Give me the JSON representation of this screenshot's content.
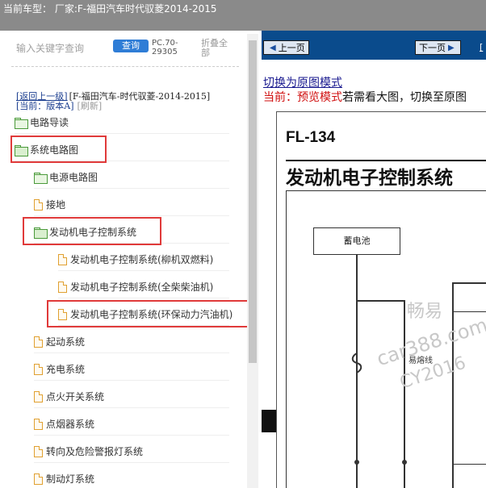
{
  "header": {
    "title": "当前车型：  厂家:F-福田汽车时代驭菱2014-2015"
  },
  "sidebar": {
    "search_placeholder": "输入关键字查询",
    "query_label": "查询",
    "pc_code": "PC.70-29305",
    "fold_all_label": "折叠全部",
    "back_label": "[返回上一级]",
    "path_label": "[F-福田汽车-时代驭菱-2014-2015]",
    "current_label": "[当前：版本A]",
    "refresh_label": "[刷新]",
    "items": [
      {
        "label": "电路导读",
        "icon": "folder-icon"
      },
      {
        "label": "系统电路图",
        "icon": "folder-open-icon"
      },
      {
        "label": "电源电路图",
        "icon": "folder-icon"
      },
      {
        "label": "接地",
        "icon": "document-icon"
      },
      {
        "label": "发动机电子控制系统",
        "icon": "folder-open-icon"
      },
      {
        "label": "发动机电子控制系统(柳机双燃料)",
        "icon": "document-icon"
      },
      {
        "label": "发动机电子控制系统(全柴柴油机)",
        "icon": "document-icon"
      },
      {
        "label": "发动机电子控制系统(环保动力汽油机)",
        "icon": "document-icon"
      },
      {
        "label": "起动系统",
        "icon": "document-icon"
      },
      {
        "label": "充电系统",
        "icon": "document-icon"
      },
      {
        "label": "点火开关系统",
        "icon": "document-icon"
      },
      {
        "label": "点烟器系统",
        "icon": "document-icon"
      },
      {
        "label": "转向及危险警报灯系统",
        "icon": "document-icon"
      },
      {
        "label": "制动灯系统",
        "icon": "document-icon"
      }
    ]
  },
  "viewer": {
    "prev_label": "上一页",
    "next_label": "下一页",
    "extra_link": "[",
    "switch_label": "切换为原图模式",
    "mode_prefix": "当前：预览模式",
    "mode_suffix": "若需看大图，切换至原图",
    "diagram_code": "FL-134",
    "diagram_title": "发动机电子控制系统",
    "battery_label": "蓄电池",
    "fuse_label": "易熔线",
    "watermark_1": "畅易",
    "watermark_2": "car388.com",
    "watermark_3": "CY2016"
  },
  "colors": {
    "toolbar_bg": "#0a4b8c",
    "query_button": "#2f7dd6",
    "highlight_border": "#e03a3a",
    "mode_red": "#d01010"
  }
}
